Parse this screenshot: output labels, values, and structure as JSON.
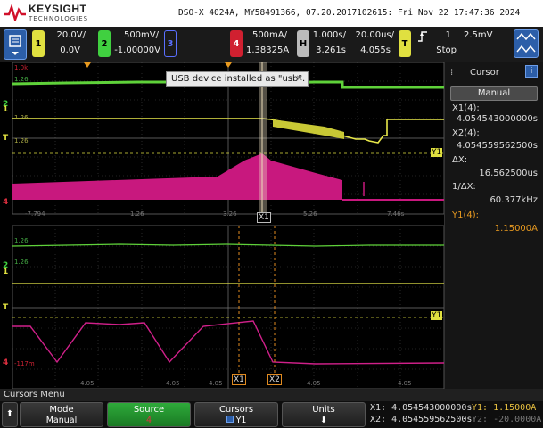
{
  "header": {
    "brand": "KEYSIGHT",
    "brand_sub": "TECHNOLOGIES",
    "title": "DSO-X 4024A, MY58491366, 07.20.2017102615: Fri Nov 22 17:47:36 2024"
  },
  "channels": [
    {
      "num": "1",
      "scale": "20.0V/",
      "offset": "0.0V",
      "color": "#e0e040"
    },
    {
      "num": "2",
      "scale": "500mV/",
      "offset": "-1.00000V",
      "color": "#40d040"
    },
    {
      "num": "3",
      "scale": "",
      "offset": "",
      "color": "#5a6fff"
    },
    {
      "num": "4",
      "scale": "500mA/",
      "offset": "1.38325A",
      "color": "#e03040"
    }
  ],
  "horizontal": {
    "label": "H",
    "time_div": "1.000s/",
    "delay": "3.261s",
    "sample": "20.00us/",
    "sample2": "4.055s"
  },
  "trigger": {
    "label": "T",
    "mode": "Stop",
    "level_chan": "1",
    "level": "2.5mV"
  },
  "tooltip": {
    "text": "USB device installed as \"usb\".",
    "close": "✕"
  },
  "cursor_panel": {
    "title": "Cursor",
    "mode": "Manual",
    "x1_label": "X1(4):",
    "x1": "4.054543000000s",
    "x2_label": "X2(4):",
    "x2": "4.054559562500s",
    "dx_label": "ΔX:",
    "dx": "16.562500us",
    "inv_label": "1/ΔX:",
    "inv": "60.377kHz",
    "y1_label": "Y1(4):",
    "y1": "1.15000A"
  },
  "plot": {
    "upper_ticks": [
      "-7.794",
      "1.26",
      "3.26",
      "5.26",
      "7.46s"
    ],
    "lower_ticks": [
      "4.05",
      "4.05",
      "4.05",
      "4.05",
      "4.05"
    ],
    "markers": {
      "x1": "X1",
      "x2": "X2",
      "y1": "Y1",
      "t": "T"
    },
    "chan_labels": {
      "c1": "1",
      "c2": "2",
      "c4": "4"
    },
    "side_vals": {
      "a": "1.0k",
      "b": "1.26",
      "c": "1.26",
      "d": "1.26",
      "e": "-117m",
      "f": "1.26",
      "g": "1.26"
    }
  },
  "menu_title": "Cursors Menu",
  "softkeys": [
    {
      "label": "Mode",
      "value": "Manual"
    },
    {
      "label": "Source",
      "value": "4"
    },
    {
      "label": "Cursors",
      "value": "Y1"
    },
    {
      "label": "Units",
      "value": "⬇"
    }
  ],
  "readout": {
    "x1": "X1: 4.054543000000s",
    "x2": "X2: 4.054559562500s",
    "y1": "Y1: 1.15000A",
    "y2": "Y2: -20.0000A"
  }
}
